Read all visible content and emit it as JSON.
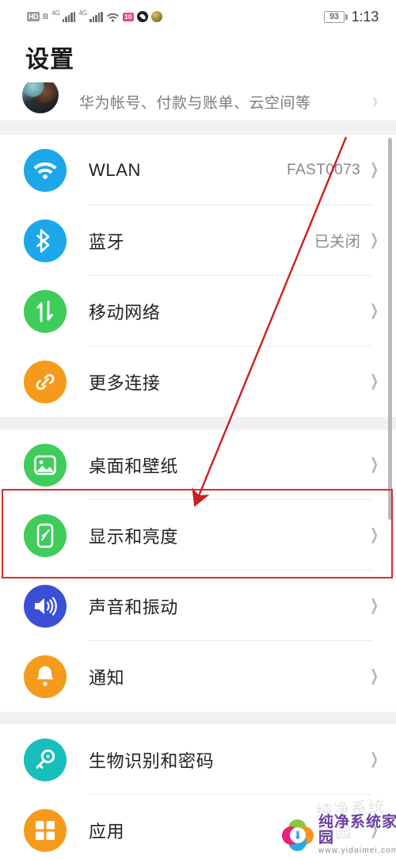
{
  "status_bar": {
    "hd_label": "HD",
    "sim_label": "B",
    "network_label_1": "4G",
    "network_label_2": "4G",
    "wifi_icon": "wifi-icon",
    "app_badge_label": "10",
    "droplet_icon": "water-drop-icon",
    "medal_icon": "medal-icon",
    "battery_percent": "93",
    "time": "1:13"
  },
  "header": {
    "title": "设置"
  },
  "account": {
    "subtitle": "华为帐号、付款与账单、云空间等",
    "avatar_name": "user-avatar",
    "chevron": "❯"
  },
  "groups": [
    {
      "name": "connectivity",
      "rows": [
        {
          "label": "WLAN",
          "value": "FAST0073",
          "icon": "wifi-icon",
          "color": "#1BA7E8",
          "chevron": "❯"
        },
        {
          "label": "蓝牙",
          "value": "已关闭",
          "icon": "bluetooth-icon",
          "color": "#1BA7E8",
          "chevron": "❯"
        },
        {
          "label": "移动网络",
          "value": "",
          "icon": "mobile-data-icon",
          "color": "#3ECC5A",
          "chevron": "❯"
        },
        {
          "label": "更多连接",
          "value": "",
          "icon": "link-icon",
          "color": "#F59B1C",
          "chevron": "❯"
        }
      ]
    },
    {
      "name": "display",
      "rows": [
        {
          "label": "桌面和壁纸",
          "value": "",
          "icon": "wallpaper-icon",
          "color": "#3ECC5A",
          "chevron": "❯"
        },
        {
          "label": "显示和亮度",
          "value": "",
          "icon": "display-brightness-icon",
          "color": "#3ECC5A",
          "chevron": "❯"
        },
        {
          "label": "声音和振动",
          "value": "",
          "icon": "speaker-icon",
          "color": "#3B4FD4",
          "chevron": "❯"
        },
        {
          "label": "通知",
          "value": "",
          "icon": "bell-icon",
          "color": "#F59B1C",
          "chevron": "❯"
        }
      ]
    },
    {
      "name": "security-apps",
      "rows": [
        {
          "label": "生物识别和密码",
          "value": "",
          "icon": "key-icon",
          "color": "#17BEBB",
          "chevron": "❯"
        },
        {
          "label": "应用",
          "value": "",
          "icon": "apps-grid-icon",
          "color": "#F59B1C",
          "chevron": "❯"
        }
      ]
    }
  ],
  "annotation": {
    "highlight_color": "#e02b2b",
    "arrow_color": "#cc1f1f",
    "highlight_target": "显示和亮度"
  },
  "watermark": {
    "brand": "纯净系统家园",
    "url": "www.yidaimei.com",
    "ghost_text": "纯净系统家园"
  }
}
